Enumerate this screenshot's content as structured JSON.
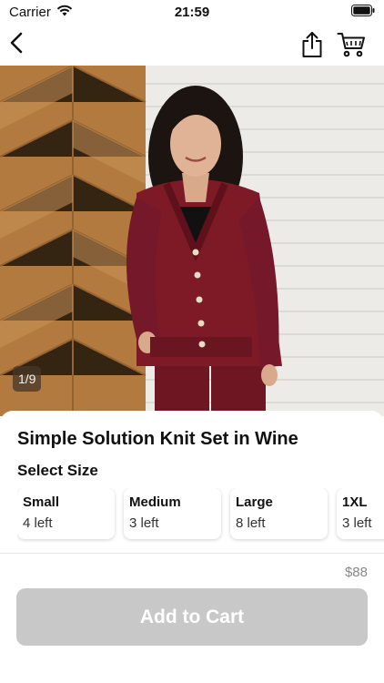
{
  "status_bar": {
    "carrier": "Carrier",
    "time": "21:59",
    "icons": [
      "wifi-icon",
      "battery-icon"
    ]
  },
  "nav": {
    "icons": [
      "back-chevron-icon",
      "share-icon",
      "cart-icon"
    ]
  },
  "gallery": {
    "counter": "1/9"
  },
  "product": {
    "title": "Simple Solution Knit Set in Wine",
    "size_heading": "Select Size",
    "sizes": [
      {
        "name": "Small",
        "stock": "4 left"
      },
      {
        "name": "Medium",
        "stock": "3 left"
      },
      {
        "name": "Large",
        "stock": "8 left"
      },
      {
        "name": "1XL",
        "stock": "3 left"
      }
    ],
    "price": "$88"
  },
  "cart_button": {
    "label": "Add to Cart",
    "enabled": false
  },
  "colors": {
    "button_disabled": "#c8c8c8",
    "sweater_wine": "#7d1a26",
    "price_text": "#888888"
  }
}
